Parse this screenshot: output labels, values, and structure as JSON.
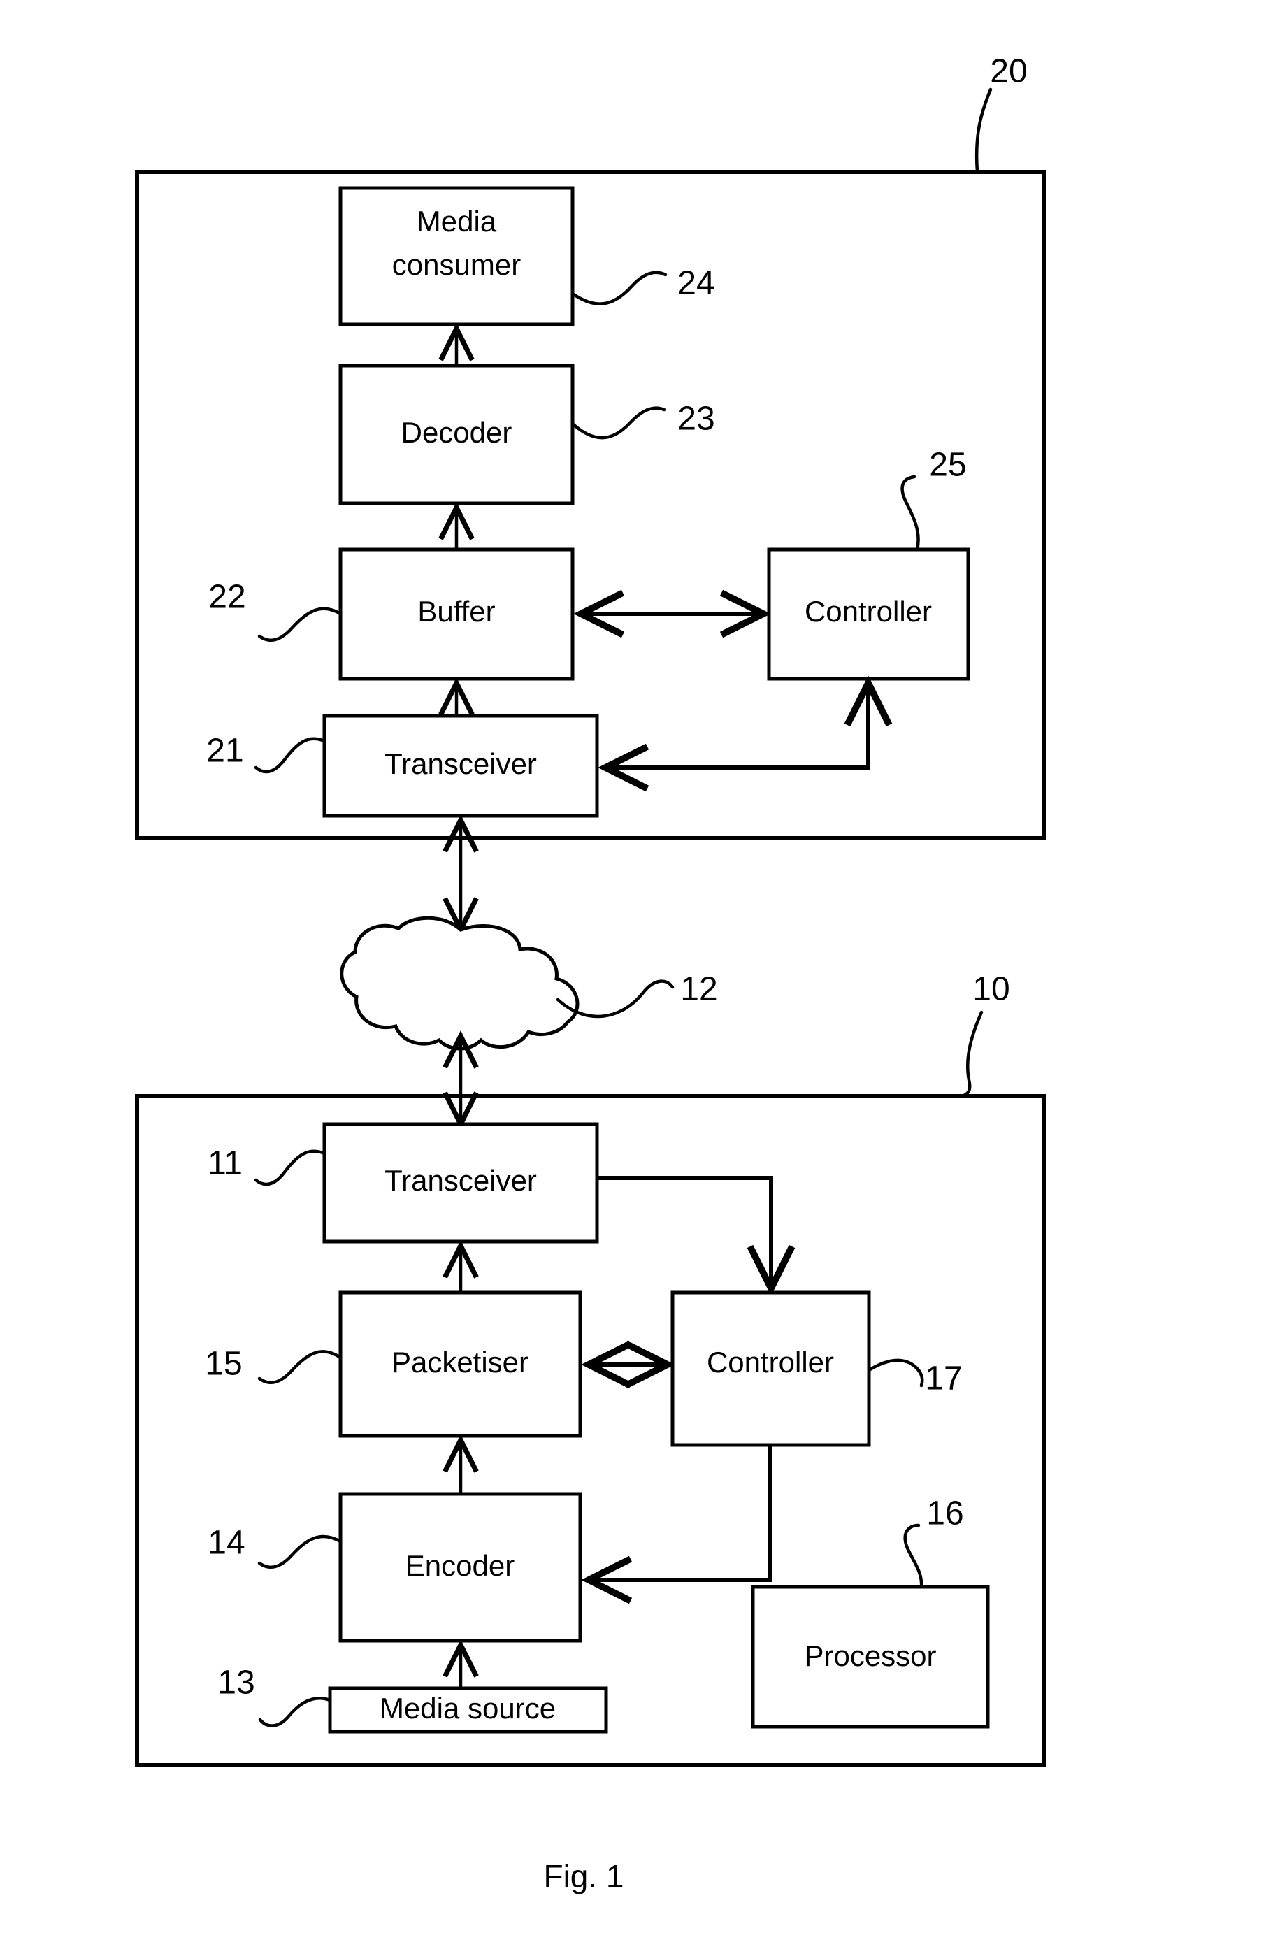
{
  "figure": {
    "caption": "Fig. 1"
  },
  "chart_data": {
    "type": "diagram",
    "title": "Fig. 1",
    "description": "Block diagram of a media streaming system with a transmitting device and a receiving device connected through a network cloud",
    "containers": [
      {
        "id": "receiver_device",
        "ref": "20",
        "label": ""
      },
      {
        "id": "transmitter_device",
        "ref": "10",
        "label": ""
      }
    ],
    "nodes": [
      {
        "id": "media_consumer",
        "label": "Media consumer",
        "ref": "24"
      },
      {
        "id": "decoder",
        "label": "Decoder",
        "ref": "23"
      },
      {
        "id": "buffer",
        "label": "Buffer",
        "ref": "22"
      },
      {
        "id": "rx_controller",
        "label": "Controller",
        "ref": "25"
      },
      {
        "id": "rx_transceiver",
        "label": "Transceiver",
        "ref": "21"
      },
      {
        "id": "network",
        "label": "",
        "ref": "12"
      },
      {
        "id": "tx_transceiver",
        "label": "Transceiver",
        "ref": "11"
      },
      {
        "id": "packetiser",
        "label": "Packetiser",
        "ref": "15"
      },
      {
        "id": "tx_controller",
        "label": "Controller",
        "ref": "17"
      },
      {
        "id": "encoder",
        "label": "Encoder",
        "ref": "14"
      },
      {
        "id": "processor",
        "label": "Processor",
        "ref": "16"
      },
      {
        "id": "media_source",
        "label": "Media source",
        "ref": "13"
      }
    ],
    "edges": [
      {
        "from": "decoder",
        "to": "media_consumer",
        "arrow": "single"
      },
      {
        "from": "buffer",
        "to": "decoder",
        "arrow": "single"
      },
      {
        "from": "buffer",
        "to": "rx_controller",
        "arrow": "double"
      },
      {
        "from": "rx_transceiver",
        "to": "buffer",
        "arrow": "single"
      },
      {
        "from": "rx_controller",
        "to": "rx_transceiver",
        "arrow": "single"
      },
      {
        "from": "network",
        "to": "rx_transceiver",
        "arrow": "double"
      },
      {
        "from": "tx_transceiver",
        "to": "network",
        "arrow": "double"
      },
      {
        "from": "tx_transceiver",
        "to": "tx_controller",
        "arrow": "single"
      },
      {
        "from": "packetiser",
        "to": "tx_transceiver",
        "arrow": "single"
      },
      {
        "from": "packetiser",
        "to": "tx_controller",
        "arrow": "double"
      },
      {
        "from": "encoder",
        "to": "packetiser",
        "arrow": "single"
      },
      {
        "from": "tx_controller",
        "to": "encoder",
        "arrow": "single"
      },
      {
        "from": "media_source",
        "to": "encoder",
        "arrow": "single"
      }
    ]
  },
  "receiver": {
    "ref": "20",
    "media_consumer": {
      "label_line1": "Media",
      "label_line2": "consumer",
      "ref": "24"
    },
    "decoder": {
      "label": "Decoder",
      "ref": "23"
    },
    "buffer": {
      "label": "Buffer",
      "ref": "22"
    },
    "controller": {
      "label": "Controller",
      "ref": "25"
    },
    "transceiver": {
      "label": "Transceiver",
      "ref": "21"
    }
  },
  "network": {
    "ref": "12"
  },
  "transmitter": {
    "ref": "10",
    "transceiver": {
      "label": "Transceiver",
      "ref": "11"
    },
    "packetiser": {
      "label": "Packetiser",
      "ref": "15"
    },
    "controller": {
      "label": "Controller",
      "ref": "17"
    },
    "encoder": {
      "label": "Encoder",
      "ref": "14"
    },
    "processor": {
      "label": "Processor",
      "ref": "16"
    },
    "media_source": {
      "label": "Media source",
      "ref": "13"
    }
  },
  "colors": {
    "ink": "#000000",
    "paper": "#ffffff"
  }
}
